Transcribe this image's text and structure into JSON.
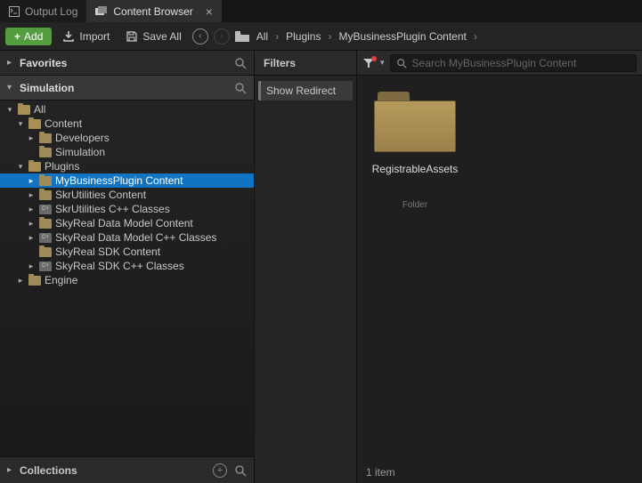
{
  "tabs": {
    "output_log": "Output Log",
    "content_browser": "Content Browser"
  },
  "toolbar": {
    "add": "Add",
    "import": "Import",
    "save_all": "Save All"
  },
  "breadcrumb": {
    "root": "All",
    "plugins": "Plugins",
    "plugin": "MyBusinessPlugin Content"
  },
  "panels": {
    "favorites": "Favorites",
    "simulation": "Simulation",
    "collections": "Collections",
    "filters": "Filters"
  },
  "filter_chip": "Show Redirect",
  "tree": {
    "all": "All",
    "content": "Content",
    "developers": "Developers",
    "simulation": "Simulation",
    "plugins": "Plugins",
    "mybiz": "MyBusinessPlugin Content",
    "skr_content": "SkrUtilities Content",
    "skr_cpp": "SkrUtilities C++ Classes",
    "sky_dm_content": "SkyReal Data Model Content",
    "sky_dm_cpp": "SkyReal Data Model C++ Classes",
    "sky_sdk_content": "SkyReal SDK Content",
    "sky_sdk_cpp": "SkyReal SDK C++ Classes",
    "engine": "Engine"
  },
  "search": {
    "placeholder": "Search MyBusinessPlugin Content"
  },
  "asset": {
    "name": "RegistrableAssets",
    "type": "Folder"
  },
  "status": {
    "count": "1 item"
  }
}
